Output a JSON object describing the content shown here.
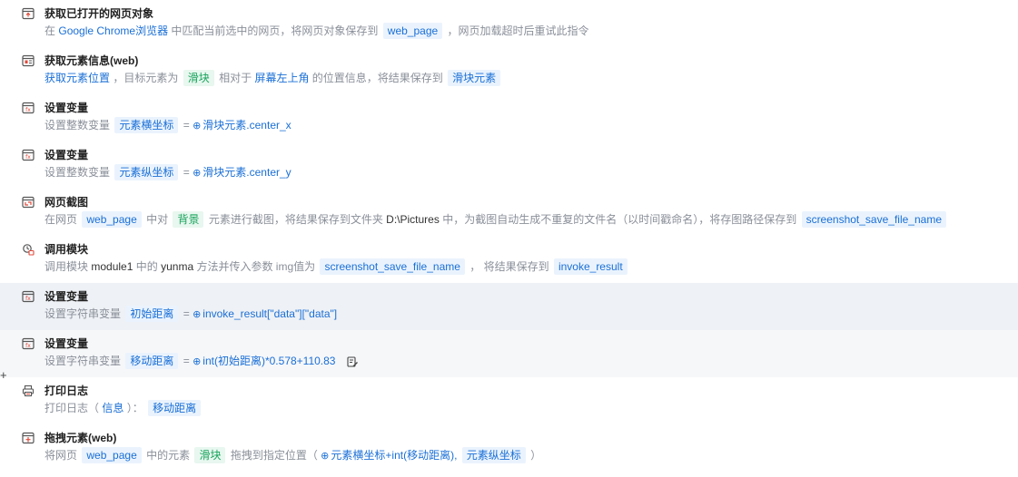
{
  "rows": [
    {
      "icon": "browser-open-icon",
      "title": "获取已打开的网页对象",
      "parts": {
        "p1": "在",
        "l1": "Google Chrome浏览器",
        "p2": "中匹配当前选中的网页，将网页对象保存到",
        "t1": "web_page",
        "p3": "，网页加载超时后重试此指令"
      }
    },
    {
      "icon": "element-info-icon",
      "title": "获取元素信息(web)",
      "parts": {
        "l1": "获取元素位置",
        "p1": "，目标元素为",
        "t1": "滑块",
        "p2": "相对于",
        "l2": "屏幕左上角",
        "p3": "的位置信息，将结果保存到",
        "t2": "滑块元素"
      }
    },
    {
      "icon": "variable-icon",
      "title": "设置变量",
      "parts": {
        "p1": "设置整数变量",
        "t1": "元素横坐标",
        "eq": "=",
        "e1": "滑块元素.center_x"
      }
    },
    {
      "icon": "variable-icon",
      "title": "设置变量",
      "parts": {
        "p1": "设置整数变量",
        "t1": "元素纵坐标",
        "eq": "=",
        "e1": "滑块元素.center_y"
      }
    },
    {
      "icon": "screenshot-icon",
      "title": "网页截图",
      "parts": {
        "p1": "在网页",
        "t1": "web_page",
        "p2": "中对",
        "t2": "背景",
        "p3": "元素进行截图，将结果保存到文件夹",
        "d1": "D:\\Pictures",
        "p4": "中，为截图自动生成不重复的文件名（以时间戳命名），将存图路径保存到",
        "t3": "screenshot_save_file_name"
      }
    },
    {
      "icon": "module-icon",
      "title": "调用模块",
      "parts": {
        "p1": "调用模块",
        "d1": "module1",
        "p2": "中的",
        "d2": "yunma",
        "p3": "方法并传入参数 img值为",
        "t1": "screenshot_save_file_name",
        "p4": "，  将结果保存到",
        "t2": "invoke_result"
      }
    },
    {
      "icon": "variable-icon",
      "title": "设置变量",
      "parts": {
        "p1": "设置字符串变量",
        "t1": "初始距离",
        "eq": "=",
        "e1": "invoke_result[\"data\"][\"data\"]"
      }
    },
    {
      "icon": "variable-icon",
      "title": "设置变量",
      "parts": {
        "p1": "设置字符串变量",
        "t1": "移动距离",
        "eq": "=",
        "e1": "int(初始距离)*0.578+110.83"
      }
    },
    {
      "icon": "print-log-icon",
      "title": "打印日志",
      "parts": {
        "p1": "打印日志（",
        "l1": "信息",
        "p2": "）：",
        "t1": "移动距离"
      }
    },
    {
      "icon": "drag-element-icon",
      "title": "拖拽元素(web)",
      "parts": {
        "p1": "将网页",
        "t1": "web_page",
        "p2": "中的元素",
        "t2": "滑块",
        "p3": "拖拽到指定位置（",
        "e1": "元素横坐标+int(移动距离),",
        "t3": "元素纵坐标",
        "p4": "）"
      }
    }
  ],
  "gutter": {
    "plus": "+"
  }
}
